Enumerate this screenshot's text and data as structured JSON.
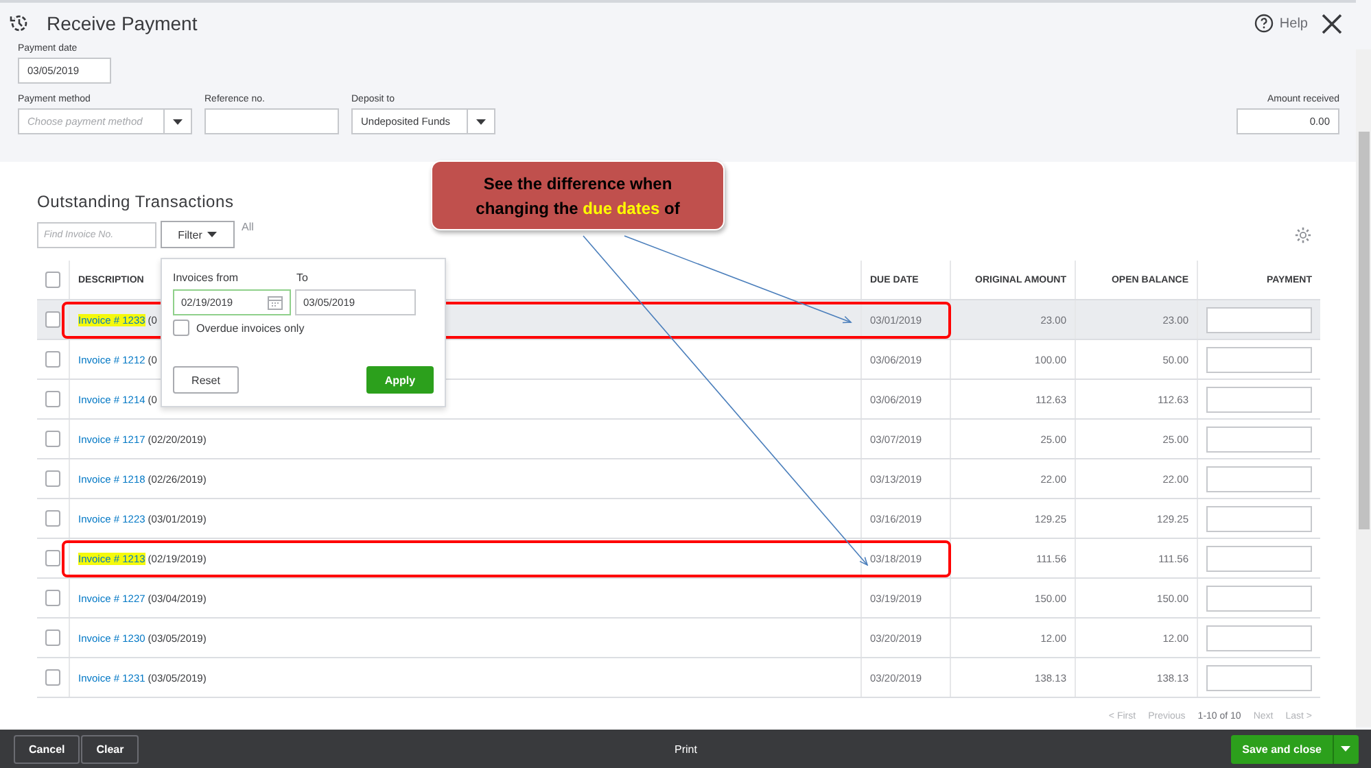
{
  "header": {
    "title": "Receive Payment",
    "help": "Help"
  },
  "form": {
    "payment_date": {
      "label": "Payment date",
      "value": "03/05/2019"
    },
    "payment_method": {
      "label": "Payment method",
      "placeholder": "Choose payment method"
    },
    "reference": {
      "label": "Reference no."
    },
    "deposit_to": {
      "label": "Deposit to",
      "value": "Undeposited Funds"
    },
    "amount_received": {
      "label": "Amount received",
      "value": "0.00"
    }
  },
  "transactions": {
    "title": "Outstanding Transactions",
    "search_placeholder": "Find Invoice No.",
    "filter": "Filter",
    "filter_value": "All",
    "columns": [
      "DESCRIPTION",
      "DUE DATE",
      "ORIGINAL AMOUNT",
      "OPEN BALANCE",
      "PAYMENT"
    ],
    "header_checked": false,
    "rows": [
      {
        "invoice": "Invoice # 1233",
        "date": "(0",
        "due": "03/01/2019",
        "original": "23.00",
        "open": "23.00",
        "checked": false,
        "selected": true,
        "highlighted": true,
        "boxed": true
      },
      {
        "invoice": "Invoice # 1212",
        "date": "(0",
        "due": "03/06/2019",
        "original": "100.00",
        "open": "50.00",
        "checked": false,
        "selected": false,
        "highlighted": false,
        "boxed": false
      },
      {
        "invoice": "Invoice # 1214",
        "date": "(0",
        "due": "03/06/2019",
        "original": "112.63",
        "open": "112.63",
        "checked": false,
        "selected": false,
        "highlighted": false,
        "boxed": false
      },
      {
        "invoice": "Invoice # 1217",
        "date": "(02/20/2019)",
        "due": "03/07/2019",
        "original": "25.00",
        "open": "25.00",
        "checked": false,
        "selected": false,
        "highlighted": false,
        "boxed": false
      },
      {
        "invoice": "Invoice # 1218",
        "date": "(02/26/2019)",
        "due": "03/13/2019",
        "original": "22.00",
        "open": "22.00",
        "checked": false,
        "selected": false,
        "highlighted": false,
        "boxed": false
      },
      {
        "invoice": "Invoice # 1223",
        "date": "(03/01/2019)",
        "due": "03/16/2019",
        "original": "129.25",
        "open": "129.25",
        "checked": false,
        "selected": false,
        "highlighted": false,
        "boxed": false
      },
      {
        "invoice": "Invoice # 1213",
        "date": "(02/19/2019)",
        "due": "03/18/2019",
        "original": "111.56",
        "open": "111.56",
        "checked": false,
        "selected": false,
        "highlighted": true,
        "boxed": true
      },
      {
        "invoice": "Invoice # 1227",
        "date": "(03/04/2019)",
        "due": "03/19/2019",
        "original": "150.00",
        "open": "150.00",
        "checked": false,
        "selected": false,
        "highlighted": false,
        "boxed": false
      },
      {
        "invoice": "Invoice # 1230",
        "date": "(03/05/2019)",
        "due": "03/20/2019",
        "original": "12.00",
        "open": "12.00",
        "checked": false,
        "selected": false,
        "highlighted": false,
        "boxed": false
      },
      {
        "invoice": "Invoice # 1231",
        "date": "(03/05/2019)",
        "due": "03/20/2019",
        "original": "138.13",
        "open": "138.13",
        "checked": false,
        "selected": false,
        "highlighted": false,
        "boxed": false
      }
    ],
    "pagination": [
      "< First",
      "Previous",
      "1-10 of 10",
      "Next",
      "Last >"
    ]
  },
  "filter_popup": {
    "from_label": "Invoices from",
    "to_label": "To",
    "from": "02/19/2019",
    "to": "03/05/2019",
    "overdue_label": "Overdue invoices only",
    "overdue_checked": false,
    "reset": "Reset",
    "apply": "Apply"
  },
  "callout": {
    "text": "See the difference when changing the **due dates** of"
  },
  "footer": {
    "cancel": "Cancel",
    "clear": "Clear",
    "print": "Print",
    "save": "Save and close"
  }
}
